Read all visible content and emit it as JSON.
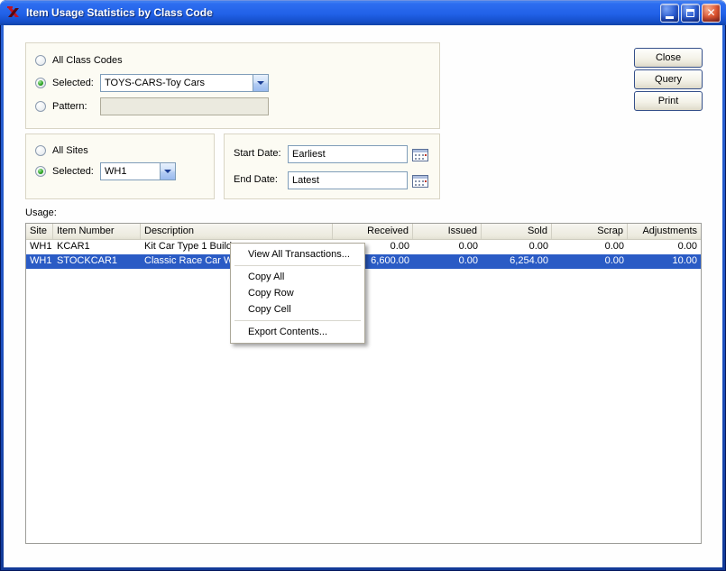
{
  "titlebar": {
    "title": "Item Usage Statistics by Class Code"
  },
  "class_codes": {
    "all_label": "All Class Codes",
    "selected_label": "Selected:",
    "selected_value": "TOYS-CARS-Toy Cars",
    "pattern_label": "Pattern:",
    "pattern_value": ""
  },
  "actions": {
    "close": "Close",
    "query": "Query",
    "print": "Print"
  },
  "sites": {
    "all_label": "All Sites",
    "selected_label": "Selected:",
    "selected_value": "WH1"
  },
  "dates": {
    "start_label": "Start Date:",
    "start_value": "Earliest",
    "end_label": "End Date:",
    "end_value": "Latest"
  },
  "usage": {
    "label": "Usage:",
    "columns": [
      "Site",
      "Item Number",
      "Description",
      "Received",
      "Issued",
      "Sold",
      "Scrap",
      "Adjustments"
    ],
    "rows": [
      {
        "site": "WH1",
        "item": "KCAR1",
        "desc": "Kit Car Type 1 Build",
        "received": "0.00",
        "issued": "0.00",
        "sold": "0.00",
        "scrap": "0.00",
        "adj": "0.00"
      },
      {
        "site": "WH1",
        "item": "STOCKCAR1",
        "desc": "Classic Race Car W",
        "received": "6,600.00",
        "issued": "0.00",
        "sold": "6,254.00",
        "scrap": "0.00",
        "adj": "10.00"
      }
    ]
  },
  "context_menu": {
    "items": [
      "View All Transactions...",
      "Copy All",
      "Copy Row",
      "Copy Cell",
      "Export Contents..."
    ]
  },
  "colors": {
    "selection_blue": "#2a5bc5",
    "titlebar_blue": "#2161e8",
    "close_red": "#de5530",
    "field_border": "#7f9db9"
  }
}
